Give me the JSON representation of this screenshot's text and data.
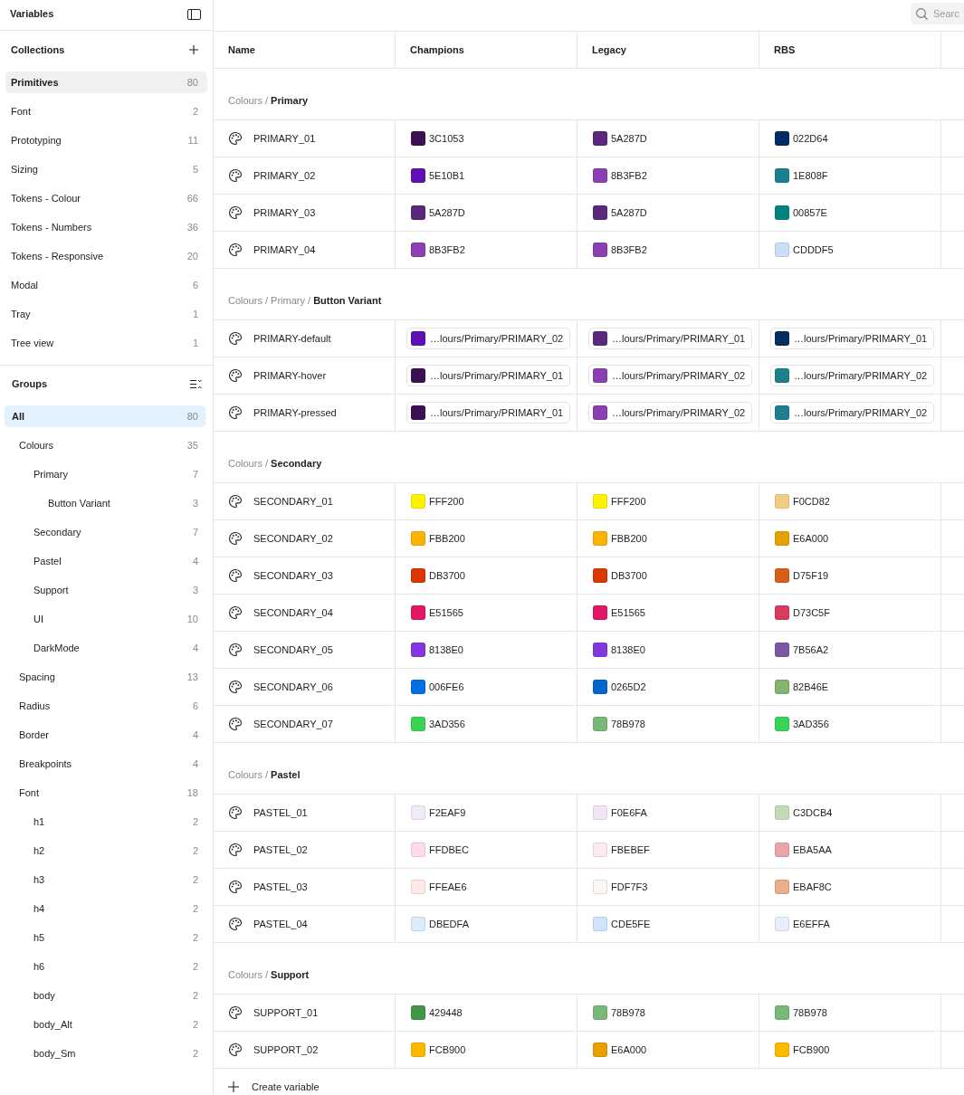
{
  "sidebar": {
    "title": "Variables",
    "collections": {
      "title": "Collections",
      "items": [
        {
          "label": "Primitives",
          "count": "80",
          "selected": true
        },
        {
          "label": "Font",
          "count": "2",
          "selected": false
        },
        {
          "label": "Prototyping",
          "count": "11",
          "selected": false
        },
        {
          "label": "Sizing",
          "count": "5",
          "selected": false
        },
        {
          "label": "Tokens - Colour",
          "count": "66",
          "selected": false
        },
        {
          "label": "Tokens - Numbers",
          "count": "36",
          "selected": false
        },
        {
          "label": "Tokens - Responsive",
          "count": "20",
          "selected": false
        },
        {
          "label": "Modal",
          "count": "6",
          "selected": false
        },
        {
          "label": "Tray",
          "count": "1",
          "selected": false
        },
        {
          "label": "Tree view",
          "count": "1",
          "selected": false
        }
      ]
    },
    "groups": {
      "title": "Groups",
      "items": [
        {
          "label": "All",
          "count": "80",
          "selected": true,
          "children": [
            {
              "label": "Colours",
              "count": "35",
              "selected": false,
              "children": [
                {
                  "label": "Primary",
                  "count": "7",
                  "selected": false,
                  "children": [
                    {
                      "label": "Button Variant",
                      "count": "3",
                      "selected": false
                    }
                  ]
                },
                {
                  "label": "Secondary",
                  "count": "7",
                  "selected": false
                },
                {
                  "label": "Pastel",
                  "count": "4",
                  "selected": false
                },
                {
                  "label": "Support",
                  "count": "3",
                  "selected": false
                },
                {
                  "label": "UI",
                  "count": "10",
                  "selected": false
                },
                {
                  "label": "DarkMode",
                  "count": "4",
                  "selected": false
                }
              ]
            },
            {
              "label": "Spacing",
              "count": "13",
              "selected": false
            },
            {
              "label": "Radius",
              "count": "6",
              "selected": false
            },
            {
              "label": "Border",
              "count": "4",
              "selected": false
            },
            {
              "label": "Breakpoints",
              "count": "4",
              "selected": false
            },
            {
              "label": "Font",
              "count": "18",
              "selected": false,
              "children": [
                {
                  "label": "h1",
                  "count": "2",
                  "selected": false
                },
                {
                  "label": "h2",
                  "count": "2",
                  "selected": false
                },
                {
                  "label": "h3",
                  "count": "2",
                  "selected": false
                },
                {
                  "label": "h4",
                  "count": "2",
                  "selected": false
                },
                {
                  "label": "h5",
                  "count": "2",
                  "selected": false
                },
                {
                  "label": "h6",
                  "count": "2",
                  "selected": false
                },
                {
                  "label": "body",
                  "count": "2",
                  "selected": false
                },
                {
                  "label": "body_Alt",
                  "count": "2",
                  "selected": false
                },
                {
                  "label": "body_Sm",
                  "count": "2",
                  "selected": false
                }
              ]
            }
          ]
        }
      ]
    }
  },
  "toolbar": {
    "search": {
      "placeholder": "Searc"
    }
  },
  "table": {
    "columns": [
      "Name",
      "Champions",
      "Legacy",
      "RBS"
    ],
    "sections": [
      {
        "title": "Colours / **Primary**",
        "rows": [
          {
            "name": "PRIMARY_01",
            "values": [
              {
                "kind": "hex",
                "text": "3C1053",
                "color": "#3c1053"
              },
              {
                "kind": "hex",
                "text": "5A287D",
                "color": "#5a287d"
              },
              {
                "kind": "hex",
                "text": "022D64",
                "color": "#022d64"
              }
            ]
          },
          {
            "name": "PRIMARY_02",
            "values": [
              {
                "kind": "hex",
                "text": "5E10B1",
                "color": "#5e10b1"
              },
              {
                "kind": "hex",
                "text": "8B3FB2",
                "color": "#8b3fb2"
              },
              {
                "kind": "hex",
                "text": "1E808F",
                "color": "#1e808f"
              }
            ]
          },
          {
            "name": "PRIMARY_03",
            "values": [
              {
                "kind": "hex",
                "text": "5A287D",
                "color": "#5a287d"
              },
              {
                "kind": "hex",
                "text": "5A287D",
                "color": "#5a287d"
              },
              {
                "kind": "hex",
                "text": "00857E",
                "color": "#00857e"
              }
            ]
          },
          {
            "name": "PRIMARY_04",
            "values": [
              {
                "kind": "hex",
                "text": "8B3FB2",
                "color": "#8b3fb2"
              },
              {
                "kind": "hex",
                "text": "8B3FB2",
                "color": "#8b3fb2"
              },
              {
                "kind": "hex",
                "text": "CDDDF5",
                "color": "#cdddf5"
              }
            ]
          }
        ]
      },
      {
        "title": "Colours / Primary / **Button Variant**",
        "rows": [
          {
            "name": "PRIMARY-default",
            "values": [
              {
                "kind": "alias",
                "text": "…lours/Primary/PRIMARY_02",
                "color": "#5e10b1"
              },
              {
                "kind": "alias",
                "text": "…lours/Primary/PRIMARY_01",
                "color": "#5a287d"
              },
              {
                "kind": "alias",
                "text": "…lours/Primary/PRIMARY_01",
                "color": "#022d64"
              }
            ]
          },
          {
            "name": "PRIMARY-hover",
            "values": [
              {
                "kind": "alias",
                "text": "…lours/Primary/PRIMARY_01",
                "color": "#3c1053"
              },
              {
                "kind": "alias",
                "text": "…lours/Primary/PRIMARY_02",
                "color": "#8b3fb2"
              },
              {
                "kind": "alias",
                "text": "…lours/Primary/PRIMARY_02",
                "color": "#1e808f"
              }
            ]
          },
          {
            "name": "PRIMARY-pressed",
            "values": [
              {
                "kind": "alias",
                "text": "…lours/Primary/PRIMARY_01",
                "color": "#3c1053"
              },
              {
                "kind": "alias",
                "text": "…lours/Primary/PRIMARY_02",
                "color": "#8b3fb2"
              },
              {
                "kind": "alias",
                "text": "…lours/Primary/PRIMARY_02",
                "color": "#1e808f"
              }
            ]
          }
        ]
      },
      {
        "title": "Colours / **Secondary**",
        "rows": [
          {
            "name": "SECONDARY_01",
            "values": [
              {
                "kind": "hex",
                "text": "FFF200",
                "color": "#fff200"
              },
              {
                "kind": "hex",
                "text": "FFF200",
                "color": "#fff200"
              },
              {
                "kind": "hex",
                "text": "F0CD82",
                "color": "#f0cd82"
              }
            ]
          },
          {
            "name": "SECONDARY_02",
            "values": [
              {
                "kind": "hex",
                "text": "FBB200",
                "color": "#fbb200"
              },
              {
                "kind": "hex",
                "text": "FBB200",
                "color": "#fbb200"
              },
              {
                "kind": "hex",
                "text": "E6A000",
                "color": "#e6a000"
              }
            ]
          },
          {
            "name": "SECONDARY_03",
            "values": [
              {
                "kind": "hex",
                "text": "DB3700",
                "color": "#db3700"
              },
              {
                "kind": "hex",
                "text": "DB3700",
                "color": "#db3700"
              },
              {
                "kind": "hex",
                "text": "D75F19",
                "color": "#d75f19"
              }
            ]
          },
          {
            "name": "SECONDARY_04",
            "values": [
              {
                "kind": "hex",
                "text": "E51565",
                "color": "#e51565"
              },
              {
                "kind": "hex",
                "text": "E51565",
                "color": "#e51565"
              },
              {
                "kind": "hex",
                "text": "D73C5F",
                "color": "#d73c5f"
              }
            ]
          },
          {
            "name": "SECONDARY_05",
            "values": [
              {
                "kind": "hex",
                "text": "8138E0",
                "color": "#8138e0"
              },
              {
                "kind": "hex",
                "text": "8138E0",
                "color": "#8138e0"
              },
              {
                "kind": "hex",
                "text": "7B56A2",
                "color": "#7b56a2"
              }
            ]
          },
          {
            "name": "SECONDARY_06",
            "values": [
              {
                "kind": "hex",
                "text": "006FE6",
                "color": "#006fe6"
              },
              {
                "kind": "hex",
                "text": "0265D2",
                "color": "#0265d2"
              },
              {
                "kind": "hex",
                "text": "82B46E",
                "color": "#82b46e"
              }
            ]
          },
          {
            "name": "SECONDARY_07",
            "values": [
              {
                "kind": "hex",
                "text": "3AD356",
                "color": "#3ad356"
              },
              {
                "kind": "hex",
                "text": "78B978",
                "color": "#78b978"
              },
              {
                "kind": "hex",
                "text": "3AD356",
                "color": "#3ad356"
              }
            ]
          }
        ]
      },
      {
        "title": "Colours / **Pastel**",
        "rows": [
          {
            "name": "PASTEL_01",
            "values": [
              {
                "kind": "hex",
                "text": "F2EAF9",
                "color": "#f2eaf9"
              },
              {
                "kind": "hex",
                "text": "F0E6FA",
                "color": "#f0e6fa"
              },
              {
                "kind": "hex",
                "text": "C3DCB4",
                "color": "#c3dcb4"
              }
            ]
          },
          {
            "name": "PASTEL_02",
            "values": [
              {
                "kind": "hex",
                "text": "FFDBEC",
                "color": "#ffdbec"
              },
              {
                "kind": "hex",
                "text": "FBEBEF",
                "color": "#fbebef"
              },
              {
                "kind": "hex",
                "text": "EBA5AA",
                "color": "#eba5aa"
              }
            ]
          },
          {
            "name": "PASTEL_03",
            "values": [
              {
                "kind": "hex",
                "text": "FFEAE6",
                "color": "#ffeae6"
              },
              {
                "kind": "hex",
                "text": "FDF7F3",
                "color": "#fdf7f3"
              },
              {
                "kind": "hex",
                "text": "EBAF8C",
                "color": "#ebaf8c"
              }
            ]
          },
          {
            "name": "PASTEL_04",
            "values": [
              {
                "kind": "hex",
                "text": "DBEDFA",
                "color": "#dbedfa"
              },
              {
                "kind": "hex",
                "text": "CDE5FE",
                "color": "#cde5fe"
              },
              {
                "kind": "hex",
                "text": "E6EFFA",
                "color": "#e6effa"
              }
            ]
          }
        ]
      },
      {
        "title": "Colours / **Support**",
        "rows": [
          {
            "name": "SUPPORT_01",
            "values": [
              {
                "kind": "hex",
                "text": "429448",
                "color": "#429448"
              },
              {
                "kind": "hex",
                "text": "78B978",
                "color": "#78b978"
              },
              {
                "kind": "hex",
                "text": "78B978",
                "color": "#78b978"
              }
            ]
          },
          {
            "name": "SUPPORT_02",
            "values": [
              {
                "kind": "hex",
                "text": "FCB900",
                "color": "#fcb900"
              },
              {
                "kind": "hex",
                "text": "E6A000",
                "color": "#e6a000"
              },
              {
                "kind": "hex",
                "text": "FCB900",
                "color": "#fcb900"
              }
            ]
          }
        ]
      }
    ],
    "create_button": {
      "label": "Create variable"
    }
  }
}
